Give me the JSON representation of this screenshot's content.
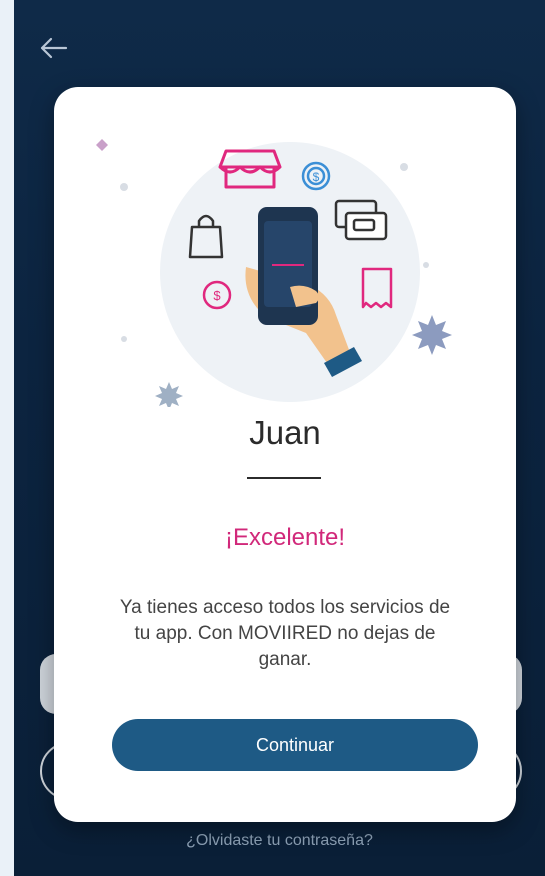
{
  "header": {
    "back_icon": "arrow-left-icon"
  },
  "modal": {
    "user_name": "Juan",
    "success_title": "¡Excelente!",
    "message": "Ya tienes acceso todos los servicios de tu app. Con MOVIIRED no dejas de ganar.",
    "continue_label": "Continuar"
  },
  "footer": {
    "forgot_password": "¿Olvidaste tu contraseña?"
  },
  "colors": {
    "background": "#0c2440",
    "accent_pink": "#d1287a",
    "button_blue": "#1e5a85"
  }
}
